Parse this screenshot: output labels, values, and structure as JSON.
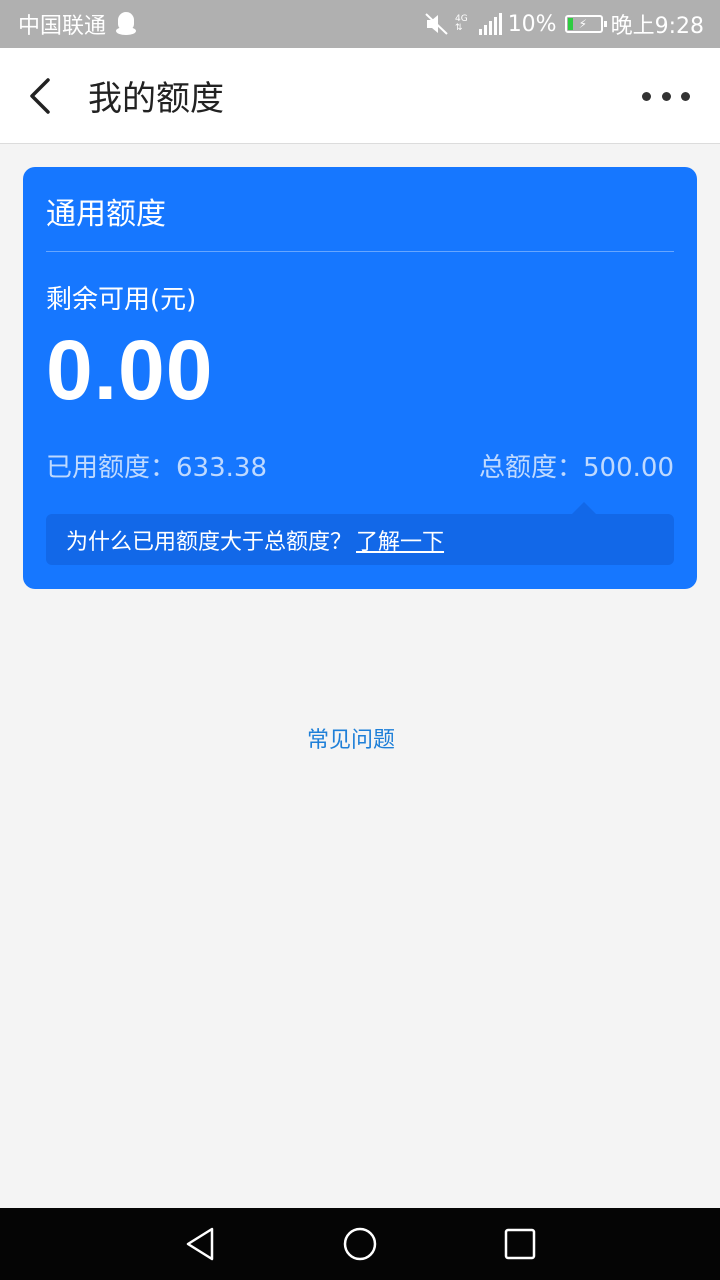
{
  "status_bar": {
    "carrier": "中国联通",
    "network": "4G",
    "battery": "10%",
    "time": "晚上9:28"
  },
  "nav": {
    "title": "我的额度",
    "back_icon": "chevron-left-icon",
    "more_icon": "more-dots-icon"
  },
  "card": {
    "title": "通用额度",
    "available_label": "剩余可用(元)",
    "available_amount": "0.00",
    "used_label": "已用额度：",
    "used_value": "633.38",
    "total_label": "总额度：",
    "total_value": "500.00",
    "tip_text": "为什么已用额度大于总额度？",
    "tip_link": "了解一下",
    "color": "#1677ff"
  },
  "faq_label": "常见问题",
  "system_nav": {
    "back_icon": "triangle-back-icon",
    "home_icon": "circle-home-icon",
    "recent_icon": "square-recent-icon"
  }
}
